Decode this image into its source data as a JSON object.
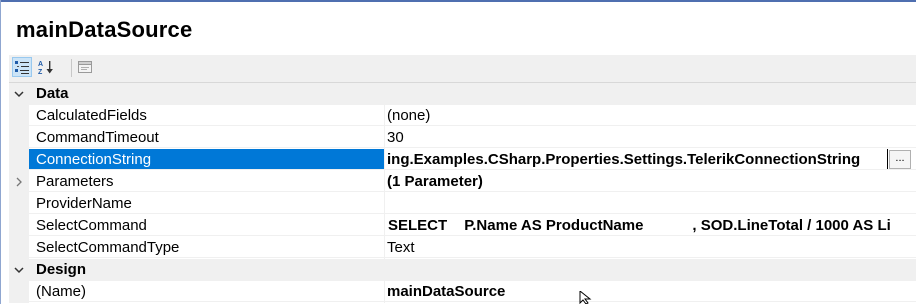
{
  "title": "mainDataSource",
  "toolbar": {
    "buttons": [
      {
        "name": "categorized-view-icon",
        "active": true
      },
      {
        "name": "alphabetical-sort-icon",
        "active": false
      },
      {
        "name": "property-pages-icon",
        "active": false
      }
    ]
  },
  "grid": {
    "categories": [
      {
        "label": "Data",
        "expanded": true
      },
      {
        "label": "Design",
        "expanded": true
      }
    ],
    "data_rows": [
      {
        "name": "CalculatedFields",
        "value": "(none)"
      },
      {
        "name": "CommandTimeout",
        "value": "30"
      },
      {
        "name": "ConnectionString",
        "value": "ing.Examples.CSharp.Properties.Settings.TelerikConnectionString",
        "button": "..."
      },
      {
        "name": "Parameters",
        "value": "(1 Parameter)"
      },
      {
        "name": "ProviderName",
        "value": ""
      },
      {
        "name": "SelectCommand",
        "value_parts": [
          "SELECT",
          "P.Name AS ProductName",
          ", SOD.LineTotal / 1000 AS Li"
        ]
      },
      {
        "name": "SelectCommandType",
        "value": "Text"
      }
    ],
    "design_rows": [
      {
        "name": "(Name)",
        "value": "mainDataSource"
      }
    ]
  },
  "colors": {
    "selection": "#0078d7",
    "category_bg": "#f0f0f0",
    "toolbar_active": "#cce4f7"
  }
}
